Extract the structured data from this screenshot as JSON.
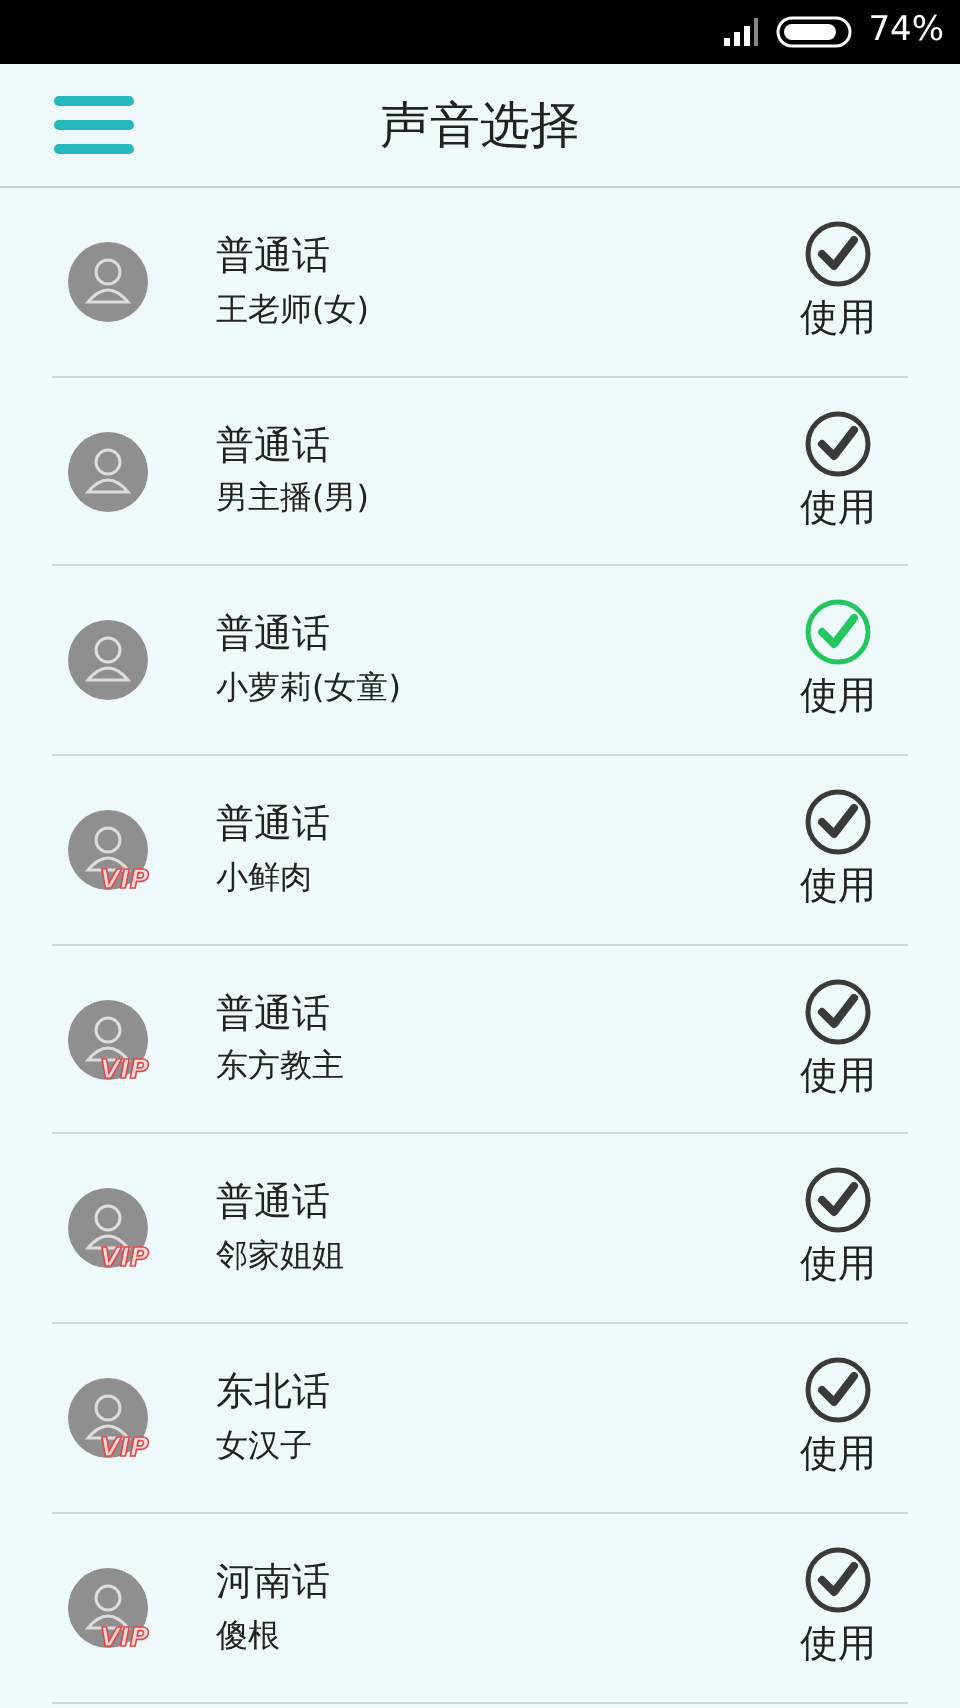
{
  "status_bar": {
    "battery": "74%"
  },
  "header": {
    "title": "声音选择"
  },
  "voices": [
    {
      "dialect": "普通话",
      "name": "王老师(女)",
      "action": "使用",
      "selected": false
    },
    {
      "dialect": "普通话",
      "name": "男主播(男)",
      "action": "使用",
      "selected": false
    },
    {
      "dialect": "普通话",
      "name": "小萝莉(女童)",
      "action": "使用",
      "selected": true
    },
    {
      "dialect": "普通话",
      "name": "小鲜肉",
      "badge": "VIP",
      "action": "使用",
      "selected": false
    },
    {
      "dialect": "普通话",
      "name": "东方教主",
      "badge": "VIP",
      "action": "使用",
      "selected": false
    },
    {
      "dialect": "普通话",
      "name": "邻家姐姐",
      "badge": "VIP",
      "action": "使用",
      "selected": false
    },
    {
      "dialect": "东北话",
      "name": "女汉子",
      "badge": "VIP",
      "action": "使用",
      "selected": false
    },
    {
      "dialect": "河南话",
      "name": "傻根",
      "badge": "VIP",
      "action": "使用",
      "selected": false
    }
  ]
}
